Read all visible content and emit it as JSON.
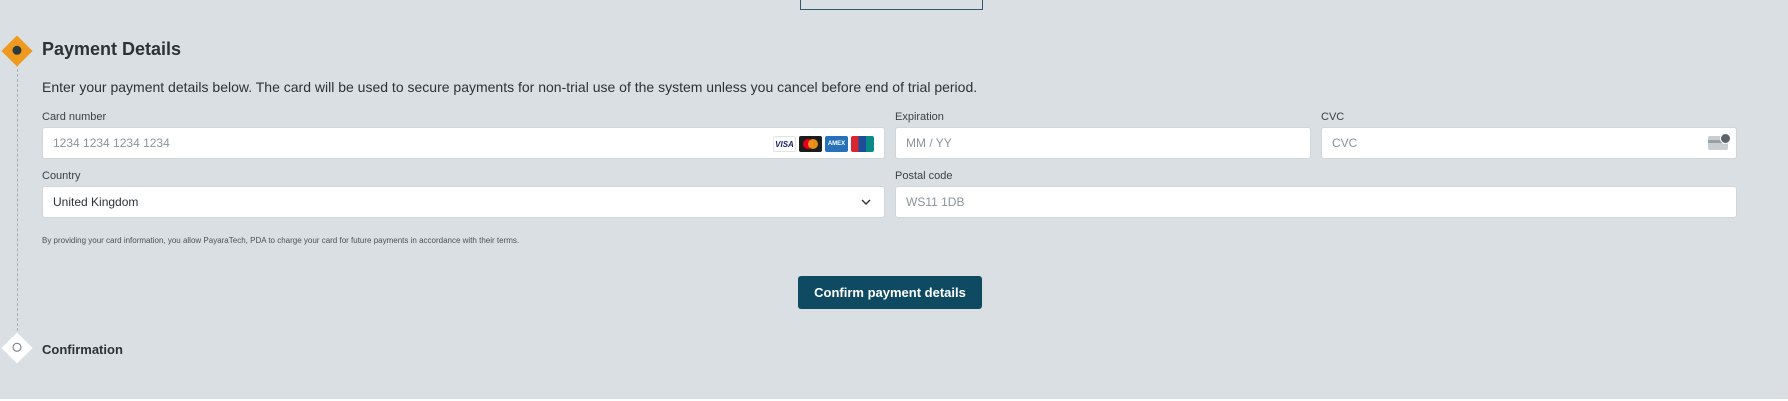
{
  "payment_step": {
    "title": "Payment Details",
    "intro": "Enter your payment details below. The card will be used to secure payments for non-trial use of the system unless you cancel before end of trial period.",
    "card_number": {
      "label": "Card number",
      "placeholder": "1234 1234 1234 1234",
      "brands": [
        "VISA",
        "Mastercard",
        "AMEX",
        "UnionPay"
      ]
    },
    "expiration": {
      "label": "Expiration",
      "placeholder": "MM / YY"
    },
    "cvc": {
      "label": "CVC",
      "placeholder": "CVC"
    },
    "country": {
      "label": "Country",
      "value": "United Kingdom"
    },
    "postal_code": {
      "label": "Postal code",
      "placeholder": "WS11 1DB"
    },
    "legal": "By providing your card information, you allow PayaraTech, PDA to charge your card for future payments in accordance with their terms.",
    "confirm_label": "Confirm payment details"
  },
  "confirmation_step": {
    "title": "Confirmation"
  },
  "icons": {
    "active_step": "active-step-icon",
    "pending_step": "pending-step-icon",
    "chevron": "chevron-down-icon",
    "cvc": "cvc-card-icon"
  },
  "colors": {
    "panel_bg": "#d9dfe3",
    "accent": "#ef9a1e",
    "primary_button": "#0f4a63"
  }
}
